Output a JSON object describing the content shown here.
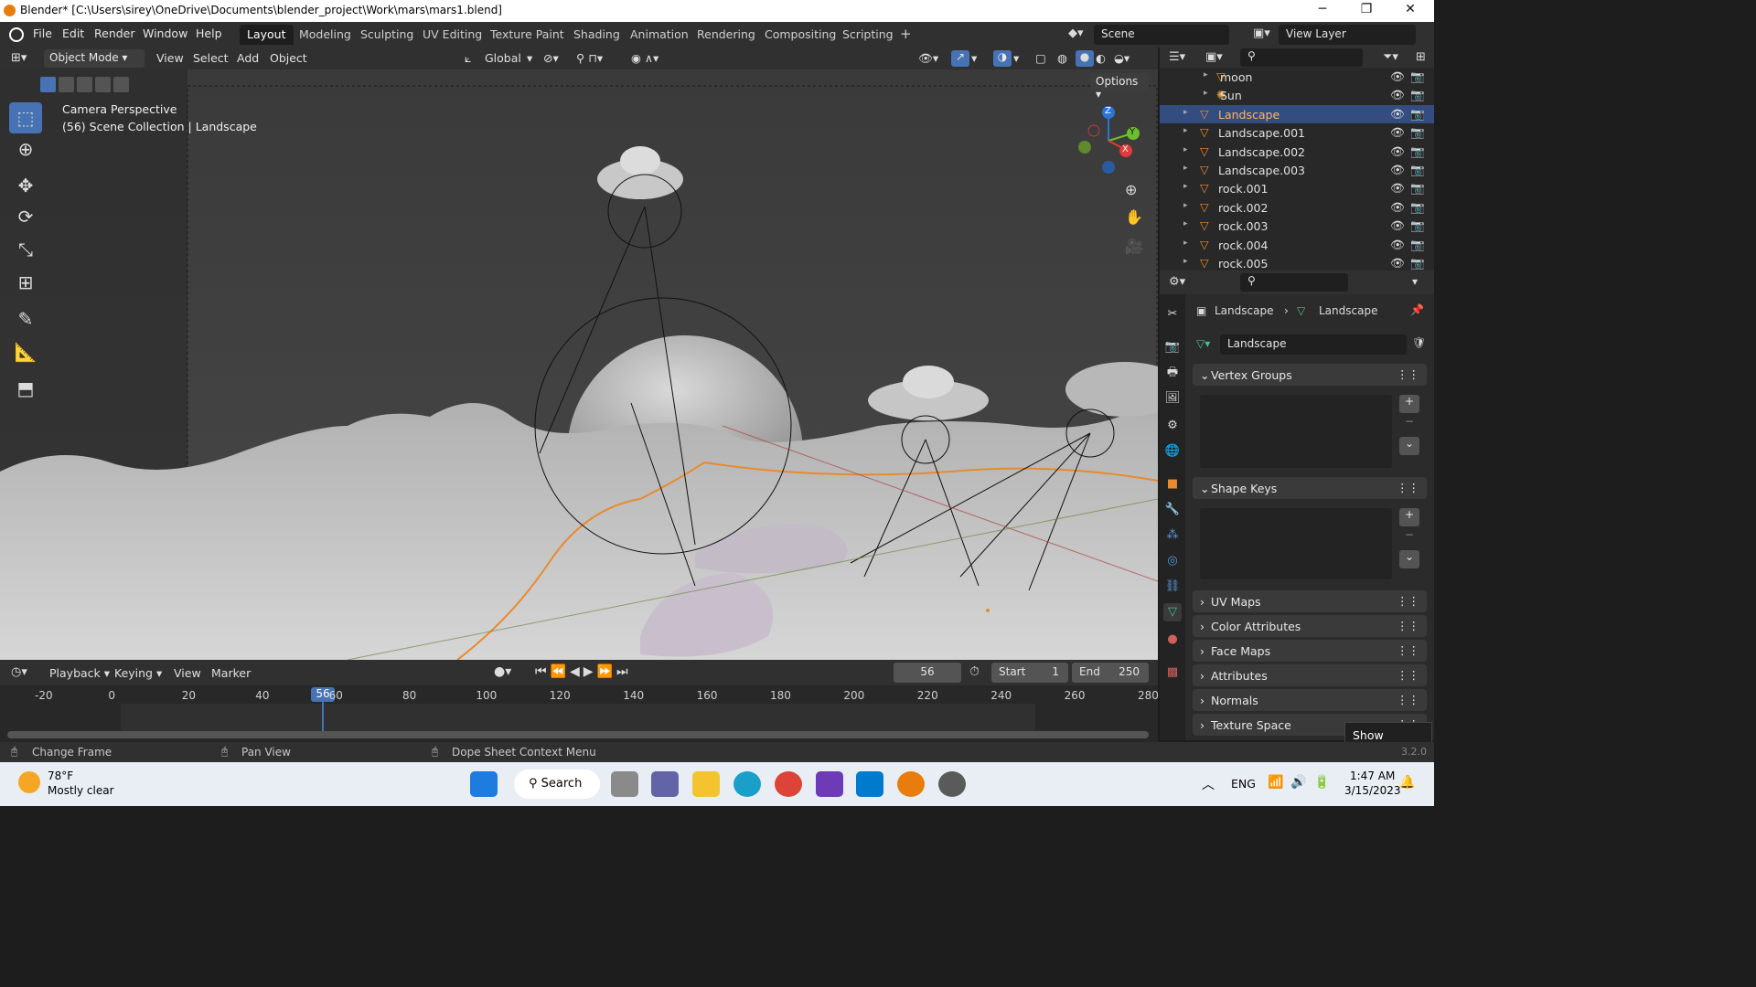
{
  "window": {
    "title": "Blender* [C:\\Users\\sirey\\OneDrive\\Documents\\blender_project\\Work\\mars\\mars1.blend]",
    "minimize": "─",
    "maximize": "❐",
    "close": "✕"
  },
  "menu": [
    "File",
    "Edit",
    "Render",
    "Window",
    "Help"
  ],
  "workspaces": [
    "Layout",
    "Modeling",
    "Sculpting",
    "UV Editing",
    "Texture Paint",
    "Shading",
    "Animation",
    "Rendering",
    "Compositing",
    "Scripting"
  ],
  "workspace_add": "+",
  "scene": "Scene",
  "view_layer": "View Layer",
  "viewport": {
    "mode": "Object Mode",
    "menus": [
      "View",
      "Select",
      "Add",
      "Object"
    ],
    "orientation": "Global",
    "options": "Options",
    "overlay_title": "Camera Perspective",
    "overlay_sub": "(56) Scene Collection | Landscape"
  },
  "gizmo": {
    "x": "X",
    "y": "Y",
    "z": "Z"
  },
  "outliner": [
    {
      "name": "moon",
      "indent": 1,
      "icon": "mesh"
    },
    {
      "name": "Sun",
      "indent": 1,
      "icon": "light"
    },
    {
      "name": "Landscape",
      "indent": 0,
      "icon": "mesh",
      "selected": true
    },
    {
      "name": "Landscape.001",
      "indent": 0,
      "icon": "mesh"
    },
    {
      "name": "Landscape.002",
      "indent": 0,
      "icon": "mesh"
    },
    {
      "name": "Landscape.003",
      "indent": 0,
      "icon": "mesh"
    },
    {
      "name": "rock.001",
      "indent": 0,
      "icon": "mesh"
    },
    {
      "name": "rock.002",
      "indent": 0,
      "icon": "mesh"
    },
    {
      "name": "rock.003",
      "indent": 0,
      "icon": "mesh"
    },
    {
      "name": "rock.004",
      "indent": 0,
      "icon": "mesh"
    },
    {
      "name": "rock.005",
      "indent": 0,
      "icon": "mesh"
    }
  ],
  "properties": {
    "breadcrumb_obj": "Landscape",
    "breadcrumb_data": "Landscape",
    "data_name": "Landscape",
    "panels_open": [
      "Vertex Groups",
      "Shape Keys"
    ],
    "panels_closed": [
      "UV Maps",
      "Color Attributes",
      "Face Maps",
      "Attributes",
      "Normals",
      "Texture Space"
    ]
  },
  "tooltip": "Show desktop",
  "timeline": {
    "menus": [
      "Playback",
      "Keying",
      "View",
      "Marker"
    ],
    "current": "56",
    "start_label": "Start",
    "start": "1",
    "end_label": "End",
    "end": "250",
    "ticks": [
      "-20",
      "0",
      "20",
      "40",
      "60",
      "80",
      "100",
      "120",
      "140",
      "160",
      "180",
      "200",
      "220",
      "240",
      "260",
      "280"
    ]
  },
  "status": {
    "left": "Change Frame",
    "mid": "Pan View",
    "right": "Dope Sheet Context Menu",
    "version": "3.2.0"
  },
  "taskbar": {
    "temp": "78°F",
    "weather": "Mostly clear",
    "search": "Search",
    "lang": "ENG",
    "time": "1:47 AM",
    "date": "3/15/2023"
  }
}
